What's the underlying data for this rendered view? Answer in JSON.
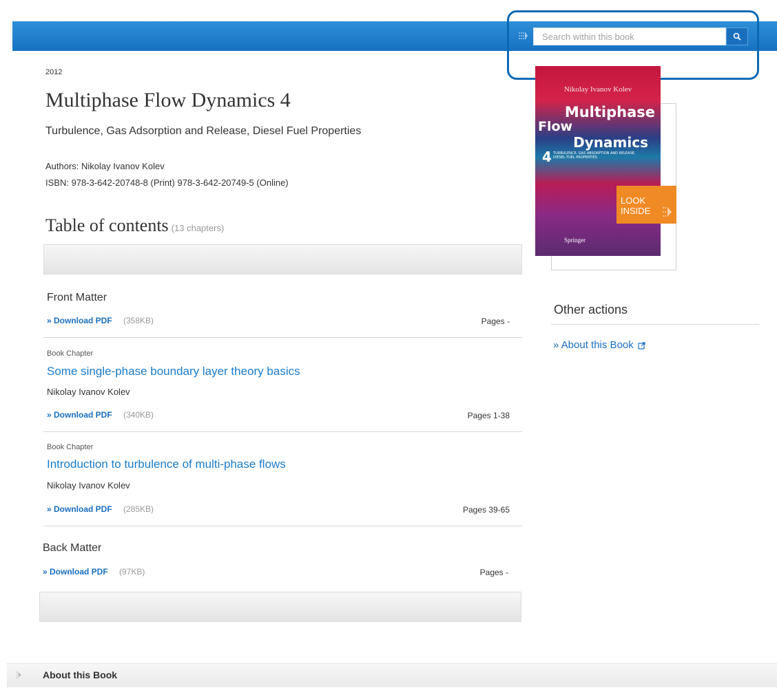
{
  "header": {
    "search": {
      "placeholder": "Search within this book"
    }
  },
  "book": {
    "year": "2012",
    "title": "Multiphase Flow Dynamics 4",
    "subtitle": "Turbulence, Gas Adsorption and Release, Diesel Fuel Properties",
    "authors": "Authors: Nikolay Ivanov Kolev",
    "isbn": "ISBN: 978-3-642-20748-8 (Print) 978-3-642-20749-5 (Online)"
  },
  "cover": {
    "author": "Nikolay Ivanov Kolev",
    "title_line1": "Multiphase",
    "title_line2": "Flow",
    "title_line3": "Dynamics",
    "volume": "4",
    "sub": "TURBULENCE, GAS ABSORPTION AND RELEASE, DIESEL FUEL PROPERTIES",
    "publisher": "Springer",
    "look_inside_line1": "LOOK",
    "look_inside_line2": "INSIDE"
  },
  "toc": {
    "heading": "Table of contents",
    "count": "(13 chapters)",
    "entries": [
      {
        "title": "Front Matter",
        "download_label": "» Download PDF",
        "size": "(358KB)",
        "pages": "Pages -"
      },
      {
        "type": "Book Chapter",
        "title": "Some single-phase boundary layer theory basics",
        "author": "Nikolay Ivanov Kolev",
        "download_label": "» Download PDF",
        "size": "(340KB)",
        "pages": "Pages 1-38"
      },
      {
        "type": "Book Chapter",
        "title": "Introduction to turbulence of multi-phase flows",
        "author": "Nikolay Ivanov Kolev",
        "download_label": "» Download PDF",
        "size": "(285KB)",
        "pages": "Pages 39-65"
      },
      {
        "title": "Back Matter",
        "download_label": "» Download PDF",
        "size": "(97KB)",
        "pages": "Pages -"
      }
    ]
  },
  "sidebar": {
    "other_actions": "Other actions",
    "about_link": "» About this Book"
  },
  "footer": {
    "about_label": "About this Book"
  },
  "colors": {
    "topbar": "#1672c2",
    "link": "#1a6fc0",
    "look_inside": "#f08a24",
    "highlight": "#0b69b4"
  }
}
